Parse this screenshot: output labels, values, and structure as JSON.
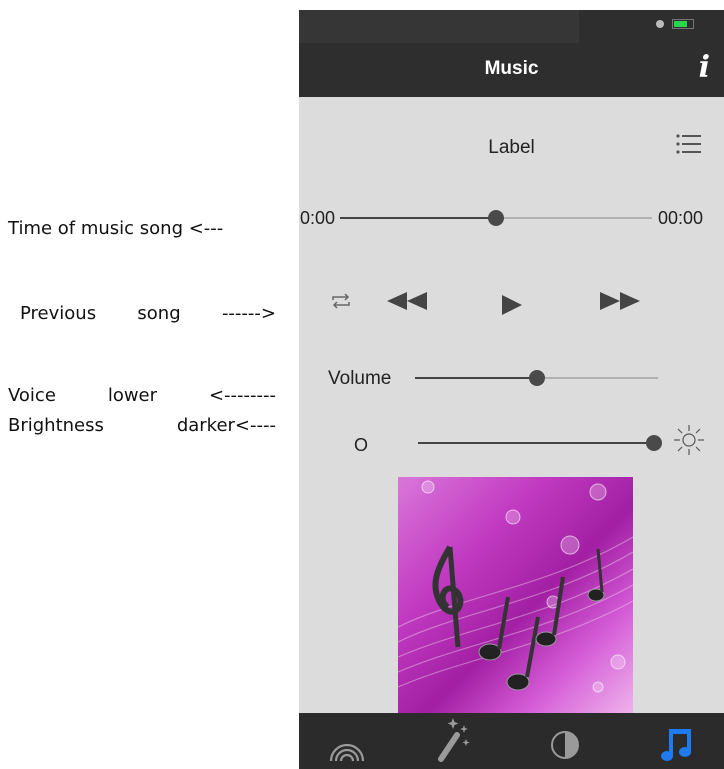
{
  "annotations": {
    "time": "Time of music song <---",
    "previous_words": [
      "Previous",
      "song",
      "------>"
    ],
    "voice_words": [
      "Voice",
      "lower",
      "<--------"
    ],
    "brightness_words": [
      "Brightness",
      "darker<----"
    ]
  },
  "navbar": {
    "title": "Music",
    "info_glyph": "i"
  },
  "player": {
    "label": "Label",
    "time_current": "0:00",
    "time_total": "00:00",
    "progress": 0.5
  },
  "volume": {
    "label": "Volume",
    "level": 0.5
  },
  "brightness": {
    "low_label": "O",
    "level": 1.0
  },
  "icons": {
    "list": "list-icon",
    "repeat": "repeat-icon",
    "rewind": "rewind-icon",
    "play": "play-icon",
    "fast_forward": "fast-forward-icon",
    "sun": "sun-icon",
    "album": "music-notes-artwork",
    "tabs": [
      "rainbow-icon",
      "magic-wand-icon",
      "timer-icon",
      "music-note-icon"
    ]
  },
  "colors": {
    "bar": "#2e2e2e",
    "background": "#dcdcdc",
    "active_tab": "#1e7cf0",
    "battery": "#27d84a"
  }
}
